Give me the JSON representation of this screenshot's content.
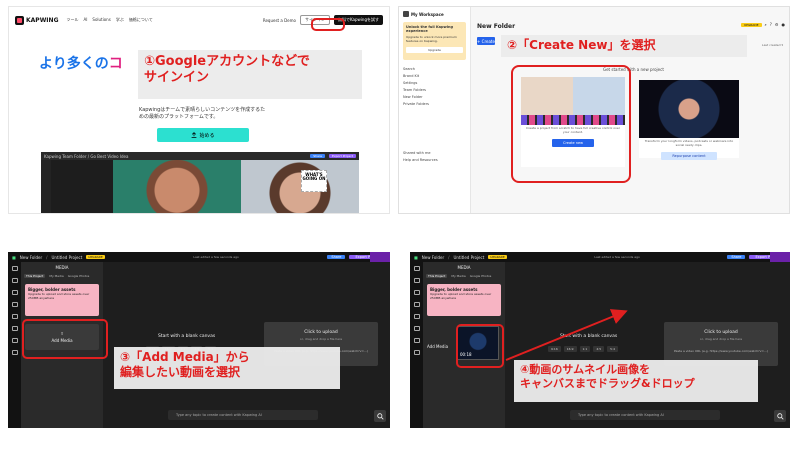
{
  "panel1": {
    "logo": "KAPWING",
    "nav_links": [
      "ツール",
      "AI",
      "Solutions",
      "学ぶ",
      "価格について"
    ],
    "request_demo": "Request a Demo",
    "signin": "サインイン",
    "try_free": "無料でKapwingを試す",
    "hero_prefix": "より多くの",
    "hero_suffix": "コ",
    "description": "Kapwingはチームで素晴らしいコンテンツを作成するための最新のプラットフォームです。",
    "cta": "始める",
    "editor_title": "Kapwing Team Folder / Go Best Video Idea",
    "editor_share": "Share",
    "editor_export": "Export Project",
    "whats_sticker": "WHAT'S GOING ON",
    "callout": "①Googleアカウントなどで\nサインイン"
  },
  "panel2": {
    "workspace": "My Workspace",
    "promo_title": "Unlock the full Kapwing experience",
    "promo_body": "Upgrade to unlock more premium features on Kapwing.",
    "promo_button": "Upgrade",
    "menu": [
      "Search",
      "Brand Kit",
      "Settings",
      "Team Folders",
      "New Folder",
      "Private Folders",
      "Shared with me",
      "Help and Resources"
    ],
    "title": "New Folder",
    "create_button": "+ Create",
    "upgrade_badge": "UPGRADE",
    "sort": "Last created ▾",
    "hint": "Get started with a new project",
    "card1_text": "Create a project from scratch to have full creative control over your content.",
    "card1_button": "Create new",
    "card2_text": "Transform your longform videos, podcasts or webinars into social ready clips.",
    "card2_button": "Repurpose content",
    "callout": "②「Create New」を選択"
  },
  "panel3": {
    "folder": "New Folder",
    "project": "Untitled Project",
    "upgrade": "UPGRADE",
    "saved": "Last edited a few seconds ago",
    "share": "Share",
    "export": "Export Project",
    "media_header": "MEDIA",
    "tabs": [
      "This Project",
      "My Media",
      "Google Photos"
    ],
    "promo_title": "Bigger, bolder assets",
    "promo_body": "Upgrade to upload and store assets over 250MB anywhere",
    "promo_button": "Upgrade",
    "add_media": "Add Media",
    "start": "Start with a blank canvas",
    "ratios": [
      "9:16",
      "16:9",
      "1:1",
      "4:5",
      "5:4"
    ],
    "upload_title": "Click to upload",
    "upload_sub": "or, drag and drop a file here",
    "paste": "Paste a video URL (e.g. https://www.youtube.com/watch?v=...)",
    "prompt": "Type any topic to create content with Kapwing AI",
    "callout": "③「Add Media」から\n編集したい動画を選択"
  },
  "panel4": {
    "folder": "New Folder",
    "project": "Untitled Project",
    "upgrade": "UPGRADE",
    "saved": "Last edited a few seconds ago",
    "share": "Share",
    "export": "Export Project",
    "media_header": "MEDIA",
    "tabs": [
      "This Project",
      "My Media",
      "Google Photos"
    ],
    "promo_title": "Bigger, bolder assets",
    "promo_body": "Upgrade to upload and store assets over 250MB anywhere",
    "promo_button": "Upgrade",
    "thumb_label": "00:18",
    "add_media": "Add Media",
    "start": "Start with a blank canvas",
    "ratios": [
      "9:16",
      "16:9",
      "1:1",
      "4:5",
      "5:4"
    ],
    "upload_title": "Click to upload",
    "upload_sub": "or, drag and drop a file here",
    "paste": "Paste a video URL (e.g. https://www.youtube.com/watch?v=...)",
    "prompt": "Type any topic to create content with Kapwing AI",
    "callout": "④動画のサムネイル画像を\nキャンバスまでドラッグ&ドロップ"
  },
  "colors": {
    "accent_red": "#e02020",
    "brand_blue": "#2563eb",
    "cta_teal": "#2ce0d0"
  }
}
